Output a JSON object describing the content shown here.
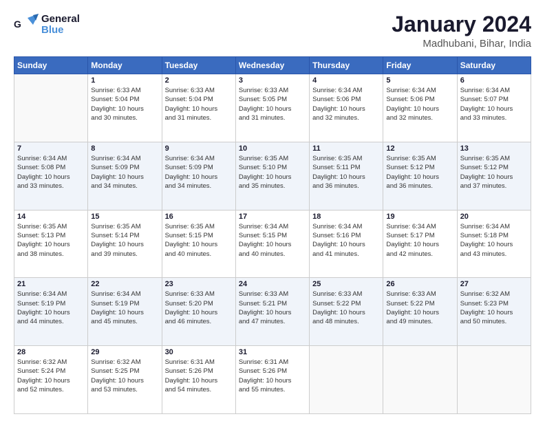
{
  "header": {
    "logo_line1": "General",
    "logo_line2": "Blue",
    "title": "January 2024",
    "subtitle": "Madhubani, Bihar, India"
  },
  "columns": [
    "Sunday",
    "Monday",
    "Tuesday",
    "Wednesday",
    "Thursday",
    "Friday",
    "Saturday"
  ],
  "weeks": [
    [
      {
        "num": "",
        "info": ""
      },
      {
        "num": "1",
        "info": "Sunrise: 6:33 AM\nSunset: 5:04 PM\nDaylight: 10 hours\nand 30 minutes."
      },
      {
        "num": "2",
        "info": "Sunrise: 6:33 AM\nSunset: 5:04 PM\nDaylight: 10 hours\nand 31 minutes."
      },
      {
        "num": "3",
        "info": "Sunrise: 6:33 AM\nSunset: 5:05 PM\nDaylight: 10 hours\nand 31 minutes."
      },
      {
        "num": "4",
        "info": "Sunrise: 6:34 AM\nSunset: 5:06 PM\nDaylight: 10 hours\nand 32 minutes."
      },
      {
        "num": "5",
        "info": "Sunrise: 6:34 AM\nSunset: 5:06 PM\nDaylight: 10 hours\nand 32 minutes."
      },
      {
        "num": "6",
        "info": "Sunrise: 6:34 AM\nSunset: 5:07 PM\nDaylight: 10 hours\nand 33 minutes."
      }
    ],
    [
      {
        "num": "7",
        "info": "Sunrise: 6:34 AM\nSunset: 5:08 PM\nDaylight: 10 hours\nand 33 minutes."
      },
      {
        "num": "8",
        "info": "Sunrise: 6:34 AM\nSunset: 5:09 PM\nDaylight: 10 hours\nand 34 minutes."
      },
      {
        "num": "9",
        "info": "Sunrise: 6:34 AM\nSunset: 5:09 PM\nDaylight: 10 hours\nand 34 minutes."
      },
      {
        "num": "10",
        "info": "Sunrise: 6:35 AM\nSunset: 5:10 PM\nDaylight: 10 hours\nand 35 minutes."
      },
      {
        "num": "11",
        "info": "Sunrise: 6:35 AM\nSunset: 5:11 PM\nDaylight: 10 hours\nand 36 minutes."
      },
      {
        "num": "12",
        "info": "Sunrise: 6:35 AM\nSunset: 5:12 PM\nDaylight: 10 hours\nand 36 minutes."
      },
      {
        "num": "13",
        "info": "Sunrise: 6:35 AM\nSunset: 5:12 PM\nDaylight: 10 hours\nand 37 minutes."
      }
    ],
    [
      {
        "num": "14",
        "info": "Sunrise: 6:35 AM\nSunset: 5:13 PM\nDaylight: 10 hours\nand 38 minutes."
      },
      {
        "num": "15",
        "info": "Sunrise: 6:35 AM\nSunset: 5:14 PM\nDaylight: 10 hours\nand 39 minutes."
      },
      {
        "num": "16",
        "info": "Sunrise: 6:35 AM\nSunset: 5:15 PM\nDaylight: 10 hours\nand 40 minutes."
      },
      {
        "num": "17",
        "info": "Sunrise: 6:34 AM\nSunset: 5:15 PM\nDaylight: 10 hours\nand 40 minutes."
      },
      {
        "num": "18",
        "info": "Sunrise: 6:34 AM\nSunset: 5:16 PM\nDaylight: 10 hours\nand 41 minutes."
      },
      {
        "num": "19",
        "info": "Sunrise: 6:34 AM\nSunset: 5:17 PM\nDaylight: 10 hours\nand 42 minutes."
      },
      {
        "num": "20",
        "info": "Sunrise: 6:34 AM\nSunset: 5:18 PM\nDaylight: 10 hours\nand 43 minutes."
      }
    ],
    [
      {
        "num": "21",
        "info": "Sunrise: 6:34 AM\nSunset: 5:19 PM\nDaylight: 10 hours\nand 44 minutes."
      },
      {
        "num": "22",
        "info": "Sunrise: 6:34 AM\nSunset: 5:19 PM\nDaylight: 10 hours\nand 45 minutes."
      },
      {
        "num": "23",
        "info": "Sunrise: 6:33 AM\nSunset: 5:20 PM\nDaylight: 10 hours\nand 46 minutes."
      },
      {
        "num": "24",
        "info": "Sunrise: 6:33 AM\nSunset: 5:21 PM\nDaylight: 10 hours\nand 47 minutes."
      },
      {
        "num": "25",
        "info": "Sunrise: 6:33 AM\nSunset: 5:22 PM\nDaylight: 10 hours\nand 48 minutes."
      },
      {
        "num": "26",
        "info": "Sunrise: 6:33 AM\nSunset: 5:22 PM\nDaylight: 10 hours\nand 49 minutes."
      },
      {
        "num": "27",
        "info": "Sunrise: 6:32 AM\nSunset: 5:23 PM\nDaylight: 10 hours\nand 50 minutes."
      }
    ],
    [
      {
        "num": "28",
        "info": "Sunrise: 6:32 AM\nSunset: 5:24 PM\nDaylight: 10 hours\nand 52 minutes."
      },
      {
        "num": "29",
        "info": "Sunrise: 6:32 AM\nSunset: 5:25 PM\nDaylight: 10 hours\nand 53 minutes."
      },
      {
        "num": "30",
        "info": "Sunrise: 6:31 AM\nSunset: 5:26 PM\nDaylight: 10 hours\nand 54 minutes."
      },
      {
        "num": "31",
        "info": "Sunrise: 6:31 AM\nSunset: 5:26 PM\nDaylight: 10 hours\nand 55 minutes."
      },
      {
        "num": "",
        "info": ""
      },
      {
        "num": "",
        "info": ""
      },
      {
        "num": "",
        "info": ""
      }
    ]
  ]
}
